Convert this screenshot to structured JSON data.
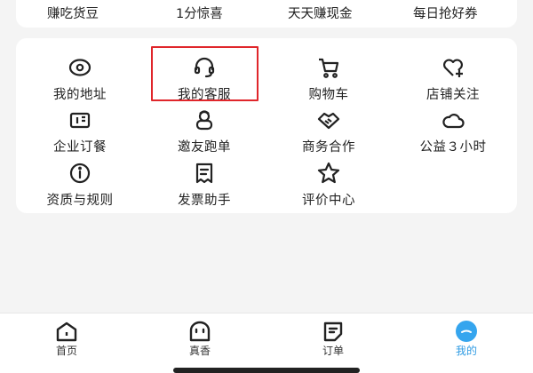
{
  "promo": {
    "items": [
      "赚吃货豆",
      "1分惊喜",
      "天天赚现金",
      "每日抢好券"
    ]
  },
  "services": {
    "rows": [
      [
        {
          "label": "我的地址",
          "icon": "location-eye-icon"
        },
        {
          "label": "我的客服",
          "icon": "headset-icon",
          "highlighted": true
        },
        {
          "label": "购物车",
          "icon": "cart-icon"
        },
        {
          "label": "店铺关注",
          "icon": "heart-plus-icon"
        }
      ],
      [
        {
          "label": "企业订餐",
          "icon": "enterprise-icon"
        },
        {
          "label": "邀友跑单",
          "icon": "invite-rider-icon"
        },
        {
          "label": "商务合作",
          "icon": "handshake-icon"
        },
        {
          "label": "公益３小时",
          "icon": "cloud-icon"
        }
      ],
      [
        {
          "label": "资质与规则",
          "icon": "info-icon"
        },
        {
          "label": "发票助手",
          "icon": "invoice-icon"
        },
        {
          "label": "评价中心",
          "icon": "star-icon"
        }
      ]
    ],
    "highlight_color": "#e0262b"
  },
  "tabbar": {
    "tabs": [
      {
        "label": "首页",
        "icon": "home-icon"
      },
      {
        "label": "真香",
        "icon": "ghost-icon"
      },
      {
        "label": "订单",
        "icon": "order-icon"
      },
      {
        "label": "我的",
        "icon": "profile-icon",
        "active": true
      }
    ],
    "active_color": "#2f9be3"
  }
}
